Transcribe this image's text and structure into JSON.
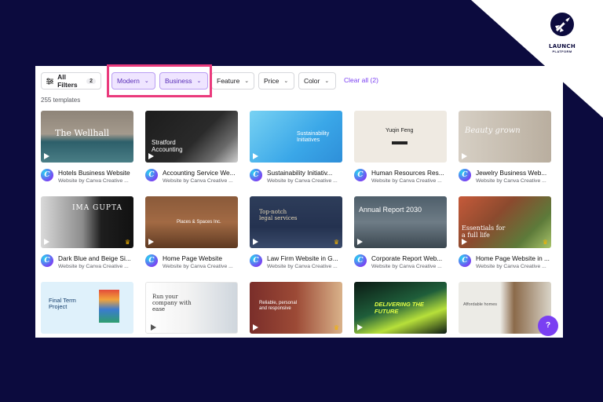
{
  "brand": {
    "name": "LAUNCH",
    "sub": "PLATFORM"
  },
  "filters": {
    "all_filters_label": "All Filters",
    "all_filters_count": "2",
    "chips": [
      "Modern",
      "Business",
      "Feature",
      "Price",
      "Color"
    ],
    "clear_label": "Clear all (2)"
  },
  "results_count": "255 templates",
  "cards": [
    {
      "title": "Hotels Business Website",
      "sub": "Website by Canva Creative ...",
      "thumb_text": "The Wellhall"
    },
    {
      "title": "Accounting Service We...",
      "sub": "Website by Canva Creative ...",
      "thumb_text": "Stratford Accounting"
    },
    {
      "title": "Sustainability Initiativ...",
      "sub": "Website by Canva Creative ...",
      "thumb_text": "Sustainability Initiatives"
    },
    {
      "title": "Human Resources Res...",
      "sub": "Website by Canva Creative ...",
      "thumb_text": "Yuqin Feng"
    },
    {
      "title": "Jewelry Business Web...",
      "sub": "Website by Canva Creative ...",
      "thumb_text": "Beauty grown"
    },
    {
      "title": "Dark Blue and Beige Si...",
      "sub": "Website by Canva Creative ...",
      "thumb_text": "IMA GUPTA"
    },
    {
      "title": "Home Page Website",
      "sub": "Website by Canva Creative ...",
      "thumb_text": "Places & Spaces Inc."
    },
    {
      "title": "Law Firm Website in G...",
      "sub": "Website by Canva Creative ...",
      "thumb_text": "Top-notch legal services"
    },
    {
      "title": "Corporate Report Web...",
      "sub": "Website by Canva Creative ...",
      "thumb_text": "Annual Report 2030"
    },
    {
      "title": "Home Page Website in ...",
      "sub": "Website by Canva Creative ...",
      "thumb_text": "Essentials for a full life"
    },
    {
      "title": "",
      "sub": "",
      "thumb_text": "Final Term Project"
    },
    {
      "title": "",
      "sub": "",
      "thumb_text": "Run your company with ease"
    },
    {
      "title": "",
      "sub": "",
      "thumb_text": "Reliable, personal and responsive"
    },
    {
      "title": "",
      "sub": "",
      "thumb_text": "DELIVERING THE FUTURE"
    },
    {
      "title": "",
      "sub": "",
      "thumb_text": "Affordable homes"
    }
  ],
  "help_label": "?",
  "colors": {
    "background": "#0c0b3e",
    "accent": "#7a3ff2",
    "highlight": "#ea3a7c"
  }
}
